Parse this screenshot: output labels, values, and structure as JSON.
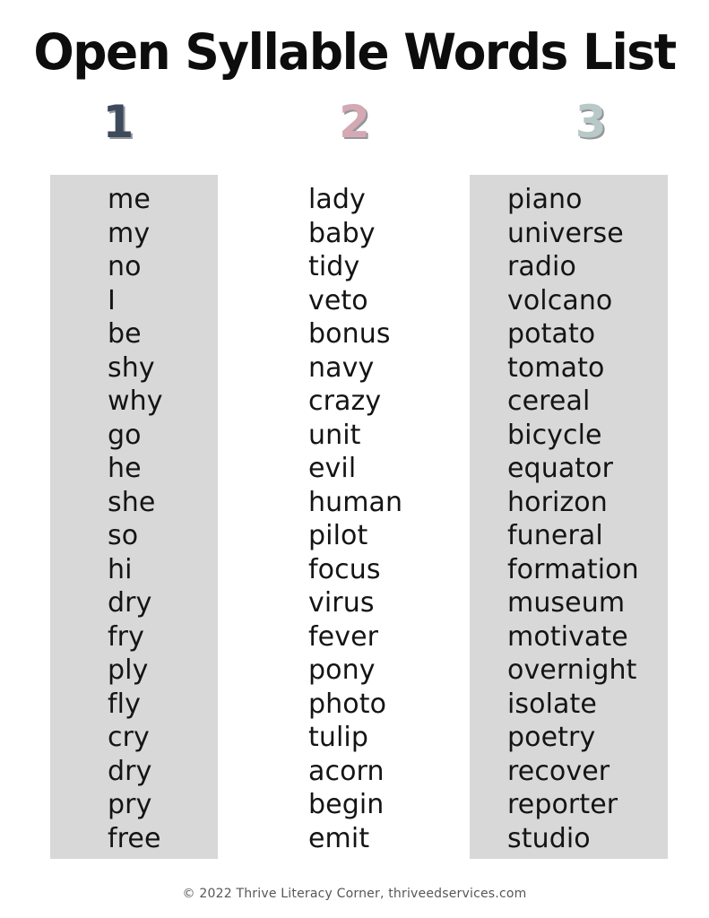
{
  "title": "Open Syllable Words List",
  "colors": {
    "column_1_number": "#3d4a5c",
    "column_2_number": "#d4a9b4",
    "column_3_number": "#b8c9c7",
    "shaded_column_background": "#d8d8d8",
    "page_background": "#ffffff",
    "text": "#141414",
    "footer_text": "#55565a"
  },
  "columns": [
    {
      "number": "1",
      "shaded": true,
      "words": [
        "me",
        "my",
        "no",
        "I",
        "be",
        "shy",
        "why",
        "go",
        "he",
        "she",
        "so",
        "hi",
        "dry",
        "fry",
        "ply",
        "fly",
        "cry",
        "dry",
        "pry",
        "free"
      ]
    },
    {
      "number": "2",
      "shaded": false,
      "words": [
        "lady",
        "baby",
        "tidy",
        "veto",
        "bonus",
        "navy",
        "crazy",
        "unit",
        "evil",
        "human",
        "pilot",
        "focus",
        "virus",
        "fever",
        "pony",
        "photo",
        "tulip",
        "acorn",
        "begin",
        "emit"
      ]
    },
    {
      "number": "3",
      "shaded": true,
      "words": [
        "piano",
        "universe",
        "radio",
        "volcano",
        "potato",
        "tomato",
        "cereal",
        "bicycle",
        "equator",
        "horizon",
        "funeral",
        "formation",
        "museum",
        "motivate",
        "overnight",
        "isolate",
        "poetry",
        "recover",
        "reporter",
        "studio"
      ]
    }
  ],
  "footer": {
    "text": "© 2022 Thrive Literacy Corner, thriveedservices.com"
  }
}
